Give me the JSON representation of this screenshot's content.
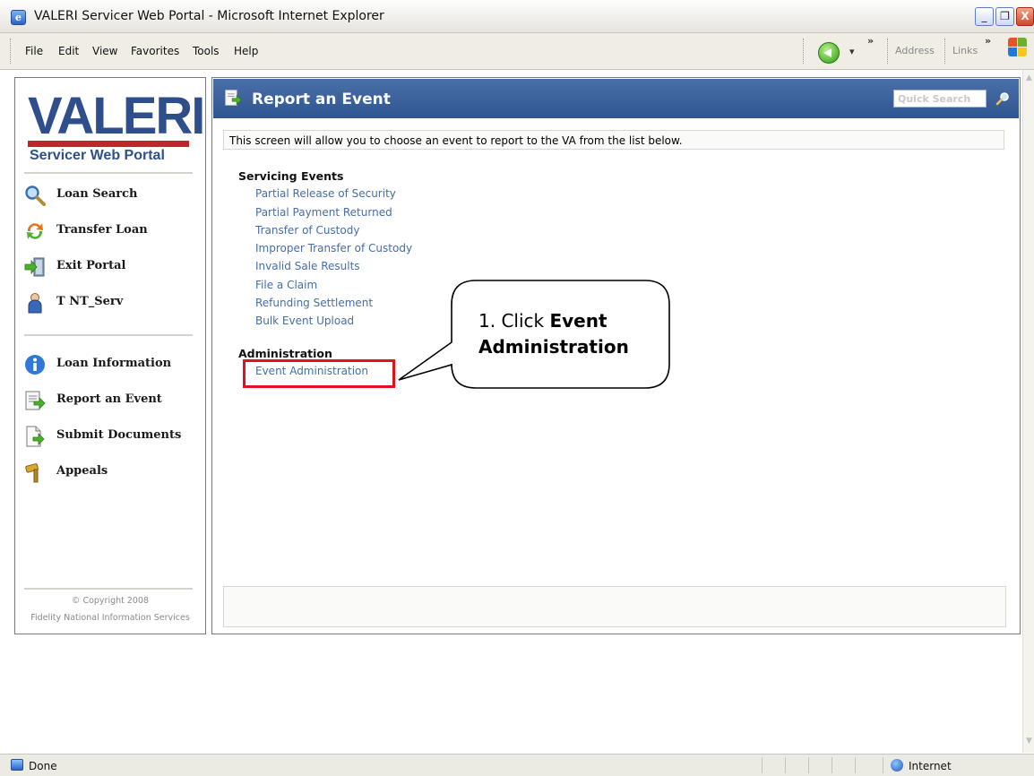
{
  "window": {
    "title": "VALERI Servicer Web Portal - Microsoft Internet Explorer",
    "buttons": {
      "minimize": "_",
      "restore": "❐",
      "close": "X"
    }
  },
  "menu": {
    "items": [
      "File",
      "Edit",
      "View",
      "Favorites",
      "Tools",
      "Help"
    ],
    "chevron1": "»",
    "address": "Address",
    "links": "Links",
    "chevron2": "»",
    "back_dropdown": "▾"
  },
  "sidebar": {
    "logo_text": "VALERI",
    "logo_subtitle": "Servicer Web Portal",
    "top_items": [
      {
        "label": "Loan Search",
        "icon": "magnifier-icon"
      },
      {
        "label": "Transfer Loan",
        "icon": "transfer-icon"
      },
      {
        "label": "Exit Portal",
        "icon": "exit-icon"
      },
      {
        "label": "T NT_Serv",
        "icon": "user-icon"
      }
    ],
    "bottom_items": [
      {
        "label": "Loan Information",
        "icon": "info-icon"
      },
      {
        "label": "Report an Event",
        "icon": "report-icon"
      },
      {
        "label": "Submit Documents",
        "icon": "document-icon"
      },
      {
        "label": "Appeals",
        "icon": "gavel-icon"
      }
    ],
    "copyright_line1": "© Copyright 2008",
    "copyright_line2": "Fidelity National Information Services"
  },
  "main": {
    "title": "Report an Event",
    "quick_search_placeholder": "Quick Search",
    "description": "This screen will allow you to choose an event to report to the VA from the list below.",
    "servicing_title": "Servicing Events",
    "servicing_links": [
      "Partial Release of Security",
      "Partial Payment Returned",
      "Transfer of Custody",
      "Improper Transfer of Custody",
      "Invalid Sale Results",
      "File a Claim",
      "Refunding Settlement",
      "Bulk Event Upload"
    ],
    "admin_title": "Administration",
    "admin_links": [
      "Event Administration"
    ]
  },
  "callout": {
    "prefix": "1. Click ",
    "bold_line1": "Event",
    "bold_line2": "Administration"
  },
  "status": {
    "text": "Done",
    "zone": "Internet"
  },
  "colors": {
    "header_blue": "#2f5590",
    "link_blue": "#466ea4",
    "highlight_red": "#e2121d",
    "logo_blue": "#2f4f8c",
    "logo_red": "#c0272d"
  }
}
